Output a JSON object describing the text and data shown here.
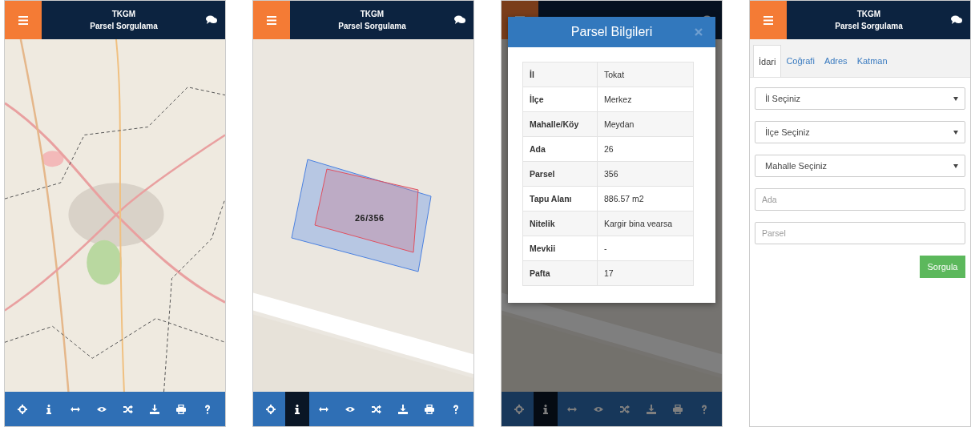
{
  "screens": [
    {
      "kind": "map",
      "header": {
        "title": "TKGM",
        "subtitle": "Parsel Sorgulama"
      },
      "map": {
        "kind": "picture"
      },
      "toolbar": [
        {
          "selected": false
        },
        {
          "selected": false
        },
        {
          "selected": false
        },
        {
          "selected": false
        },
        {
          "selected": false
        },
        {
          "selected": false
        },
        {
          "selected": false
        },
        {
          "selected": false
        }
      ]
    },
    {
      "kind": "parcel",
      "header": {
        "title": "TKGM",
        "subtitle": "Parsel Sorgulama"
      },
      "map": {
        "kind": "picture"
      },
      "parcel_label": "26/356",
      "toolbar": [
        {
          "selected": false
        },
        {
          "selected": true
        },
        {
          "selected": false
        },
        {
          "selected": false
        },
        {
          "selected": false
        },
        {
          "selected": false
        },
        {
          "selected": false
        },
        {
          "selected": false
        }
      ]
    },
    {
      "kind": "modal",
      "dimmed": true,
      "map": {
        "kind": "picture"
      },
      "modal": {
        "title": "Parsel Bilgileri",
        "rows": [
          {
            "label": "İl",
            "value": "Tokat"
          },
          {
            "label": "İlçe",
            "value": "Merkez"
          },
          {
            "label": "Mahalle/Köy",
            "value": "Meydan"
          },
          {
            "label": "Ada",
            "value": "26"
          },
          {
            "label": "Parsel",
            "value": "356"
          },
          {
            "label": "Tapu Alanı",
            "value": "886.57 m2"
          },
          {
            "label": "Nitelik",
            "value": "Kargir bina vearsa"
          },
          {
            "label": "Mevkii",
            "value": "-"
          },
          {
            "label": "Pafta",
            "value": "17"
          }
        ]
      },
      "toolbar": [
        {
          "selected": false
        },
        {
          "selected": true
        },
        {
          "selected": false
        },
        {
          "selected": false
        },
        {
          "selected": false
        },
        {
          "selected": false
        },
        {
          "selected": false
        },
        {
          "selected": false
        }
      ]
    },
    {
      "kind": "form",
      "header": {
        "title": "TKGM",
        "subtitle": "Parsel Sorgulama"
      },
      "tabs": [
        {
          "label": "İdari",
          "selected": true
        },
        {
          "label": "Coğrafi",
          "selected": false
        },
        {
          "label": "Adres",
          "selected": false
        },
        {
          "label": "Katman",
          "selected": false
        }
      ],
      "selects": [
        {
          "placeholder": "İl Seçiniz"
        },
        {
          "placeholder": "İlçe Seçiniz"
        },
        {
          "placeholder": "Mahalle Seçiniz"
        }
      ],
      "inputs": [
        {
          "placeholder": "Ada"
        },
        {
          "placeholder": "Parsel"
        }
      ],
      "button": "Sorgula"
    }
  ]
}
